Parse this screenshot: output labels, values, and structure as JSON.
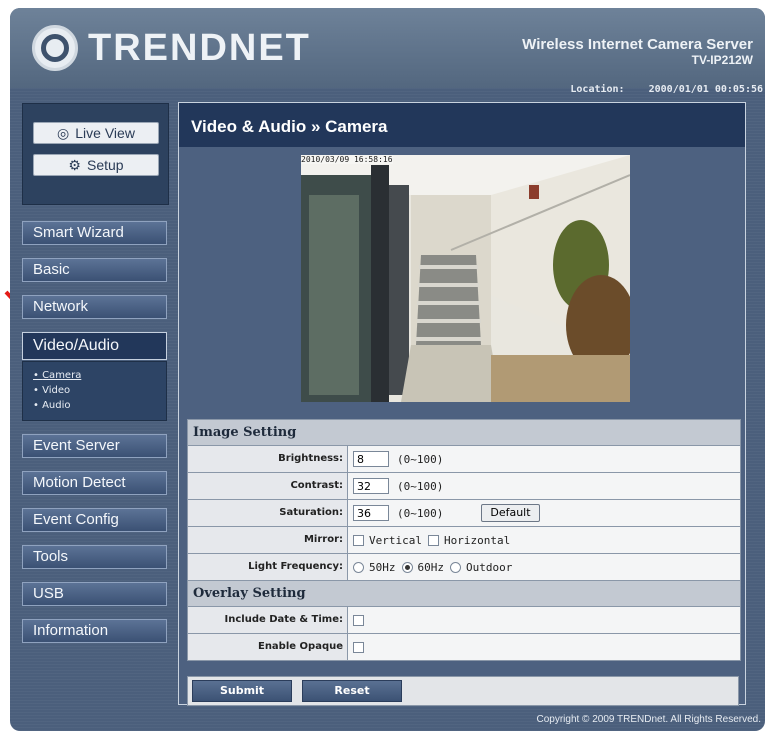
{
  "brand": {
    "logo_text": "TRENDNET",
    "product_line": "Wireless Internet Camera Server",
    "model": "TV-IP212W"
  },
  "location": {
    "label": "Location:",
    "datetime": "2000/01/01 00:05:56"
  },
  "top_buttons": {
    "live_view": "Live View",
    "setup": "Setup"
  },
  "nav": {
    "items": [
      "Smart Wizard",
      "Basic",
      "Network",
      "Video/Audio",
      "Event Server",
      "Motion Detect",
      "Event Config",
      "Tools",
      "USB",
      "Information"
    ],
    "active": "Video/Audio",
    "sub_items": [
      "Camera",
      "Video",
      "Audio"
    ]
  },
  "page": {
    "title": "Video & Audio » Camera"
  },
  "video": {
    "timestamp": "2010/03/09 16:58:16"
  },
  "image_setting": {
    "header": "Image Setting",
    "brightness": {
      "label": "Brightness:",
      "value": "8",
      "range": "(0~100)"
    },
    "contrast": {
      "label": "Contrast:",
      "value": "32",
      "range": "(0~100)"
    },
    "saturation": {
      "label": "Saturation:",
      "value": "36",
      "range": "(0~100)",
      "default_button": "Default"
    },
    "mirror": {
      "label": "Mirror:",
      "vertical": "Vertical",
      "horizontal": "Horizontal"
    },
    "light_frequency": {
      "label": "Light Frequency:",
      "options": [
        "50Hz",
        "60Hz",
        "Outdoor"
      ],
      "selected": "60Hz"
    }
  },
  "overlay_setting": {
    "header": "Overlay Setting",
    "include_date_time": "Include Date & Time:",
    "enable_opaque": "Enable Opaque"
  },
  "actions": {
    "submit": "Submit",
    "reset": "Reset"
  },
  "footer": {
    "copyright": "Copyright © 2009 TRENDnet. All Rights Reserved."
  }
}
